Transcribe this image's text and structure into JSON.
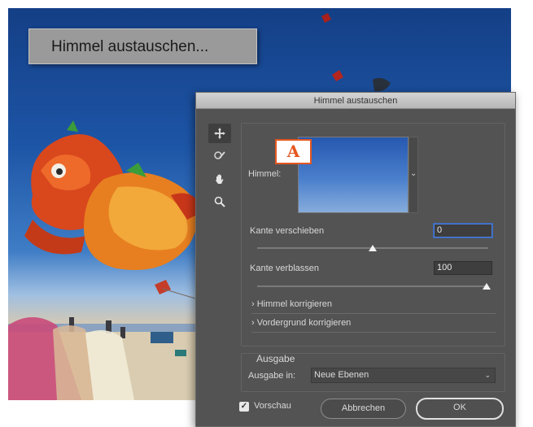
{
  "menu_label": "Himmel austauschen...",
  "dialog": {
    "title": "Himmel austauschen",
    "tools": [
      {
        "icon": "move-icon"
      },
      {
        "icon": "sky-brush-icon"
      },
      {
        "icon": "hand-icon"
      },
      {
        "icon": "zoom-icon"
      }
    ],
    "sky": {
      "label": "Himmel:",
      "callout": "A"
    },
    "edge_shift": {
      "label": "Kante verschieben",
      "value": "0",
      "slider_fraction": 0.5
    },
    "edge_fade": {
      "label": "Kante verblassen",
      "value": "100",
      "slider_fraction": 1.0
    },
    "sections": [
      {
        "label": "Himmel korrigieren"
      },
      {
        "label": "Vordergrund korrigieren"
      }
    ],
    "output": {
      "group_label": "Ausgabe",
      "field_label": "Ausgabe in:",
      "selected": "Neue Ebenen"
    },
    "preview": {
      "label": "Vorschau",
      "checked": true
    },
    "buttons": {
      "cancel": "Abbrechen",
      "ok": "OK"
    }
  },
  "colors": {
    "dialog_bg": "#535353",
    "callout": "#e55721",
    "focus": "#4d7fd9"
  }
}
